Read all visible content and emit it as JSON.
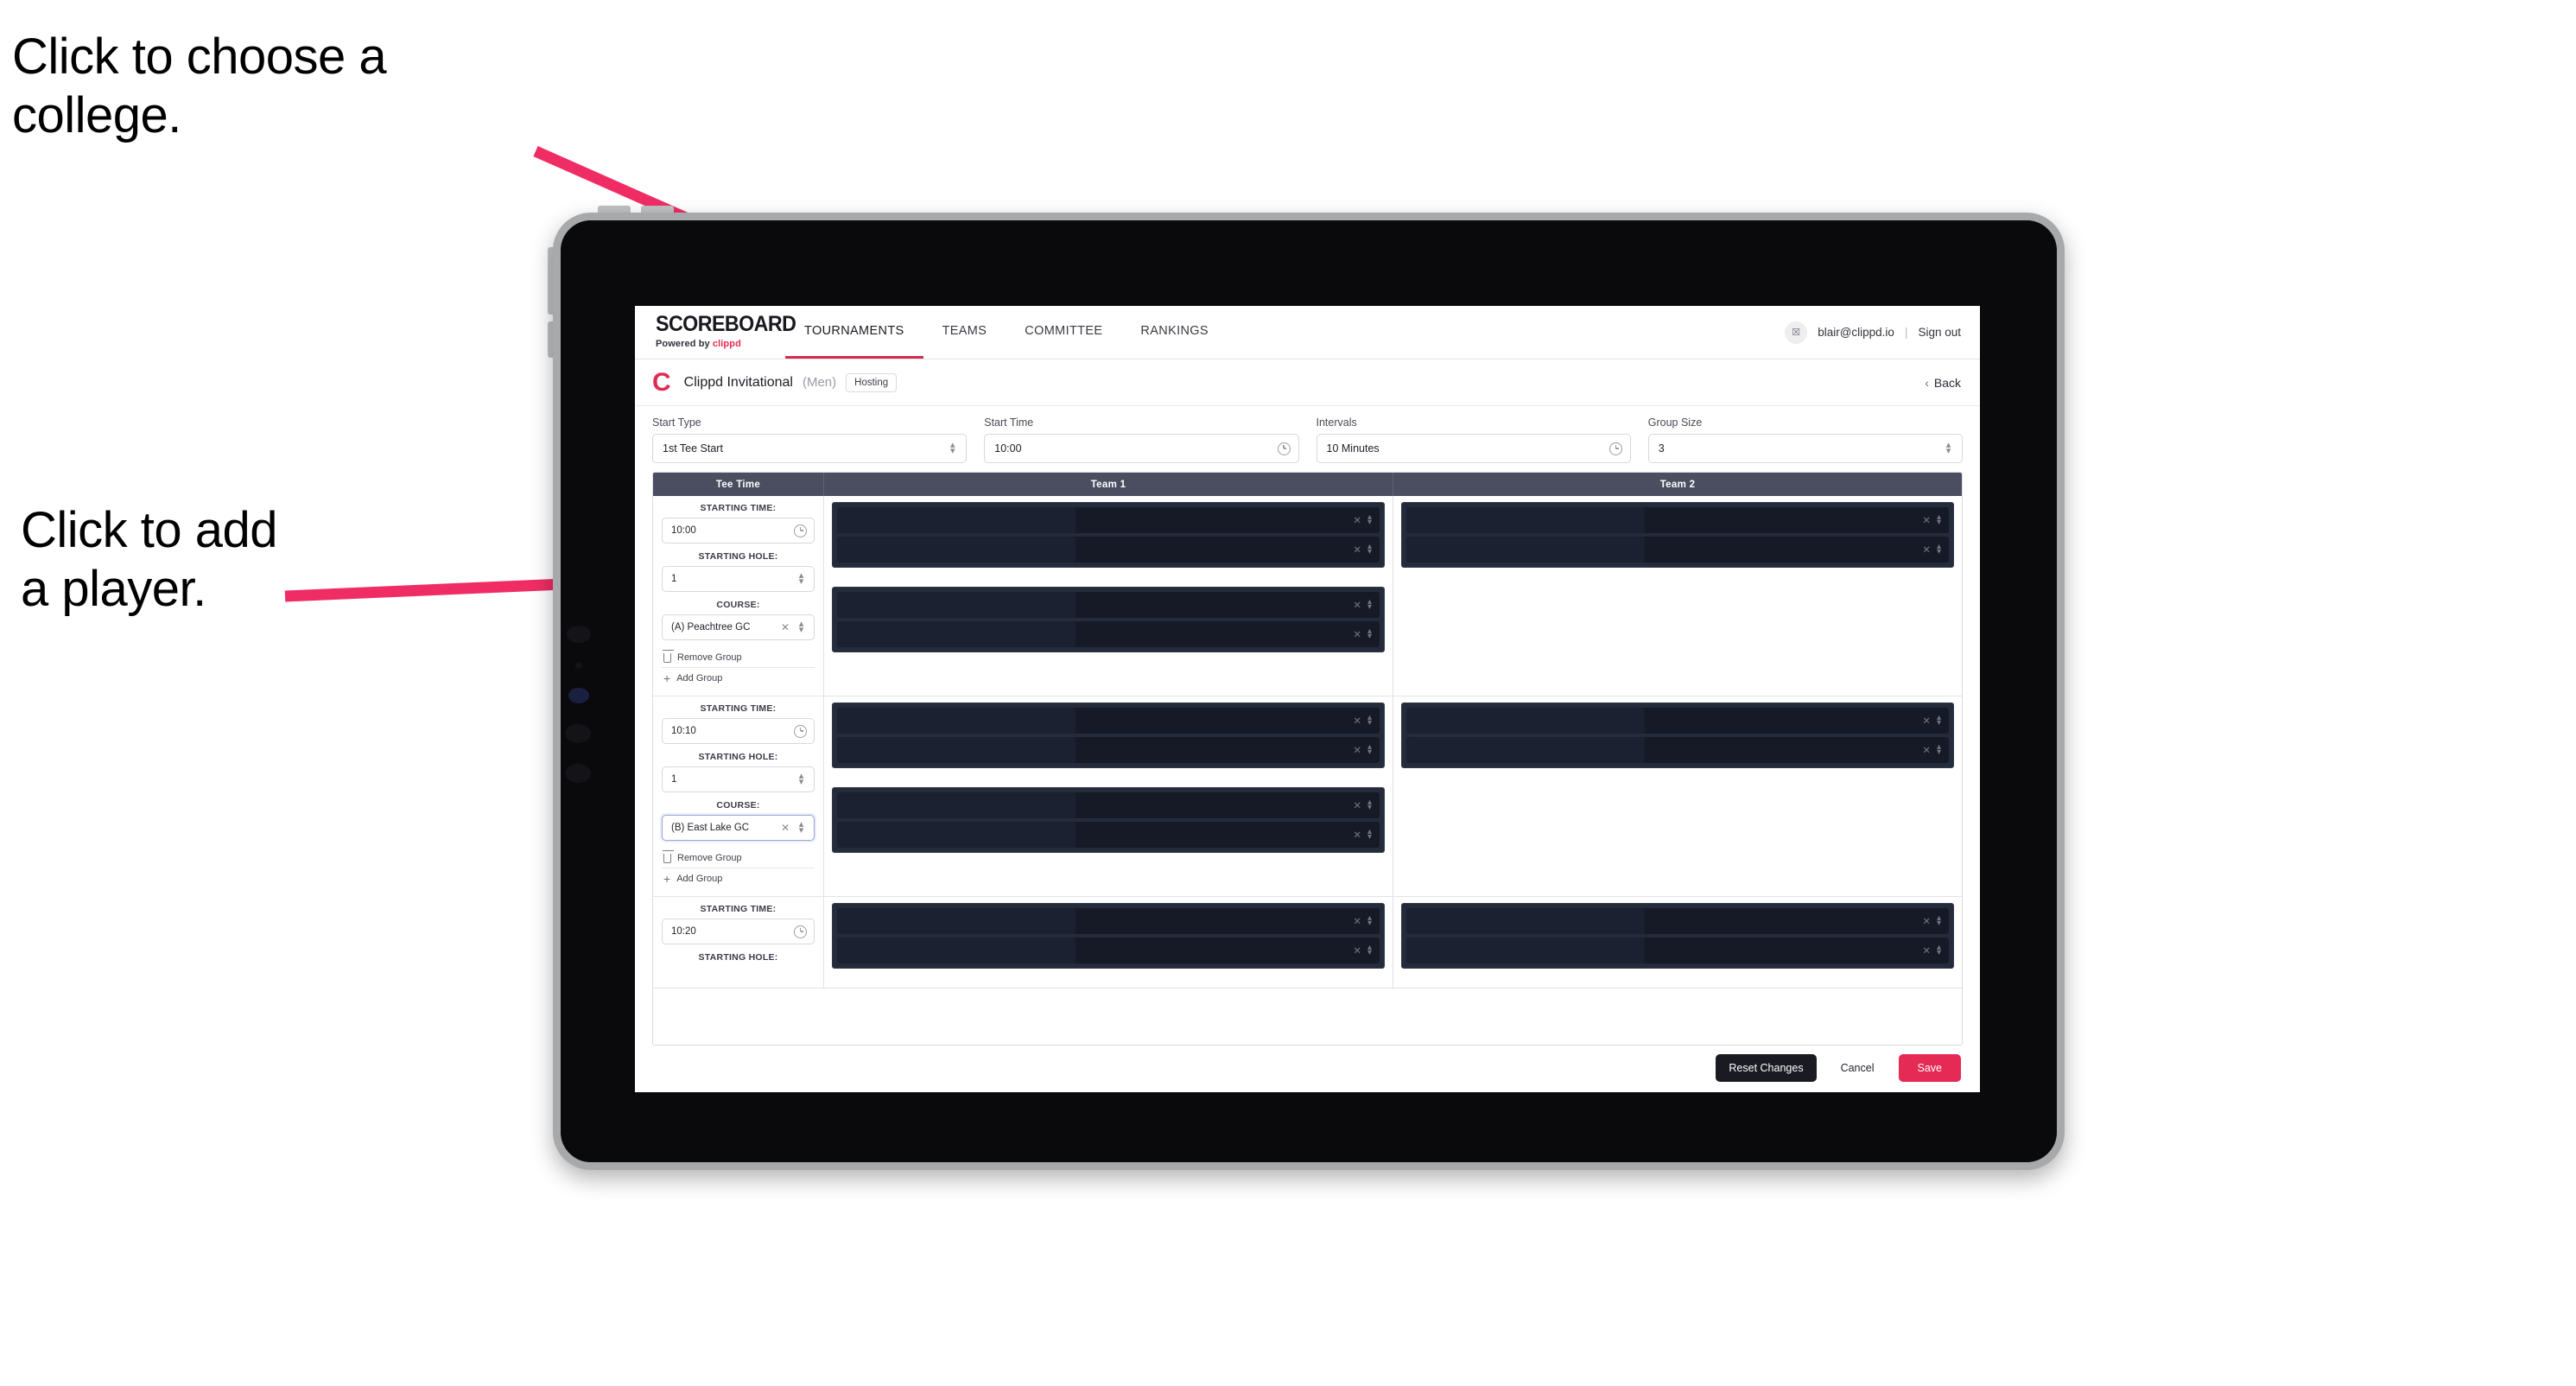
{
  "annotations": {
    "college": "Click to choose a\ncollege.",
    "player": "Click to add\na player."
  },
  "colors": {
    "accent": "#e42a55",
    "brand_red": "#d32b52",
    "table_header": "#4a4e60",
    "player_block": "#242b3a",
    "player_row": "#151a26"
  },
  "topnav": {
    "brand_word": "SCOREBOARD",
    "brand_sub_prefix": "Powered by ",
    "brand_sub_mark": "clippd",
    "tabs": [
      {
        "label": "TOURNAMENTS",
        "active": true
      },
      {
        "label": "TEAMS",
        "active": false
      },
      {
        "label": "COMMITTEE",
        "active": false
      },
      {
        "label": "RANKINGS",
        "active": false
      }
    ],
    "avatar_glyph": "☒",
    "user_email": "blair@clippd.io",
    "separator": "|",
    "sign_out": "Sign out"
  },
  "subheader": {
    "logo_letter": "C",
    "event_name": "Clippd Invitational",
    "gender": "(Men)",
    "badge": "Hosting",
    "back_chevron": "‹",
    "back_label": "Back"
  },
  "controls": [
    {
      "label": "Start Type",
      "value": "1st Tee Start",
      "widget": "stepper"
    },
    {
      "label": "Start Time",
      "value": "10:00",
      "widget": "clock"
    },
    {
      "label": "Intervals",
      "value": "10 Minutes",
      "widget": "clock"
    },
    {
      "label": "Group Size",
      "value": "3",
      "widget": "stepper"
    }
  ],
  "table": {
    "headers": [
      "Tee Time",
      "Team 1",
      "Team 2"
    ],
    "field_labels": {
      "starting_time": "STARTING TIME:",
      "starting_hole": "STARTING HOLE:",
      "course": "COURSE:"
    },
    "links": {
      "remove": "Remove Group",
      "add": "Add Group"
    },
    "rows": [
      {
        "starting_time": "10:00",
        "starting_hole": "1",
        "course": "(A) Peachtree GC",
        "course_focused": false,
        "team1_blocks": [
          2,
          2
        ],
        "team2_blocks": [
          2
        ]
      },
      {
        "starting_time": "10:10",
        "starting_hole": "1",
        "course": "(B) East Lake GC",
        "course_focused": true,
        "team1_blocks": [
          2,
          2
        ],
        "team2_blocks": [
          2
        ]
      },
      {
        "starting_time": "10:20",
        "starting_hole": "",
        "course": "",
        "course_focused": false,
        "team1_blocks": [
          2
        ],
        "team2_blocks": [
          2
        ]
      }
    ]
  },
  "footer": {
    "reset": "Reset Changes",
    "cancel": "Cancel",
    "save": "Save"
  },
  "icons": {
    "x": "✕",
    "up": "▴",
    "down": "▾",
    "plus": "+"
  }
}
